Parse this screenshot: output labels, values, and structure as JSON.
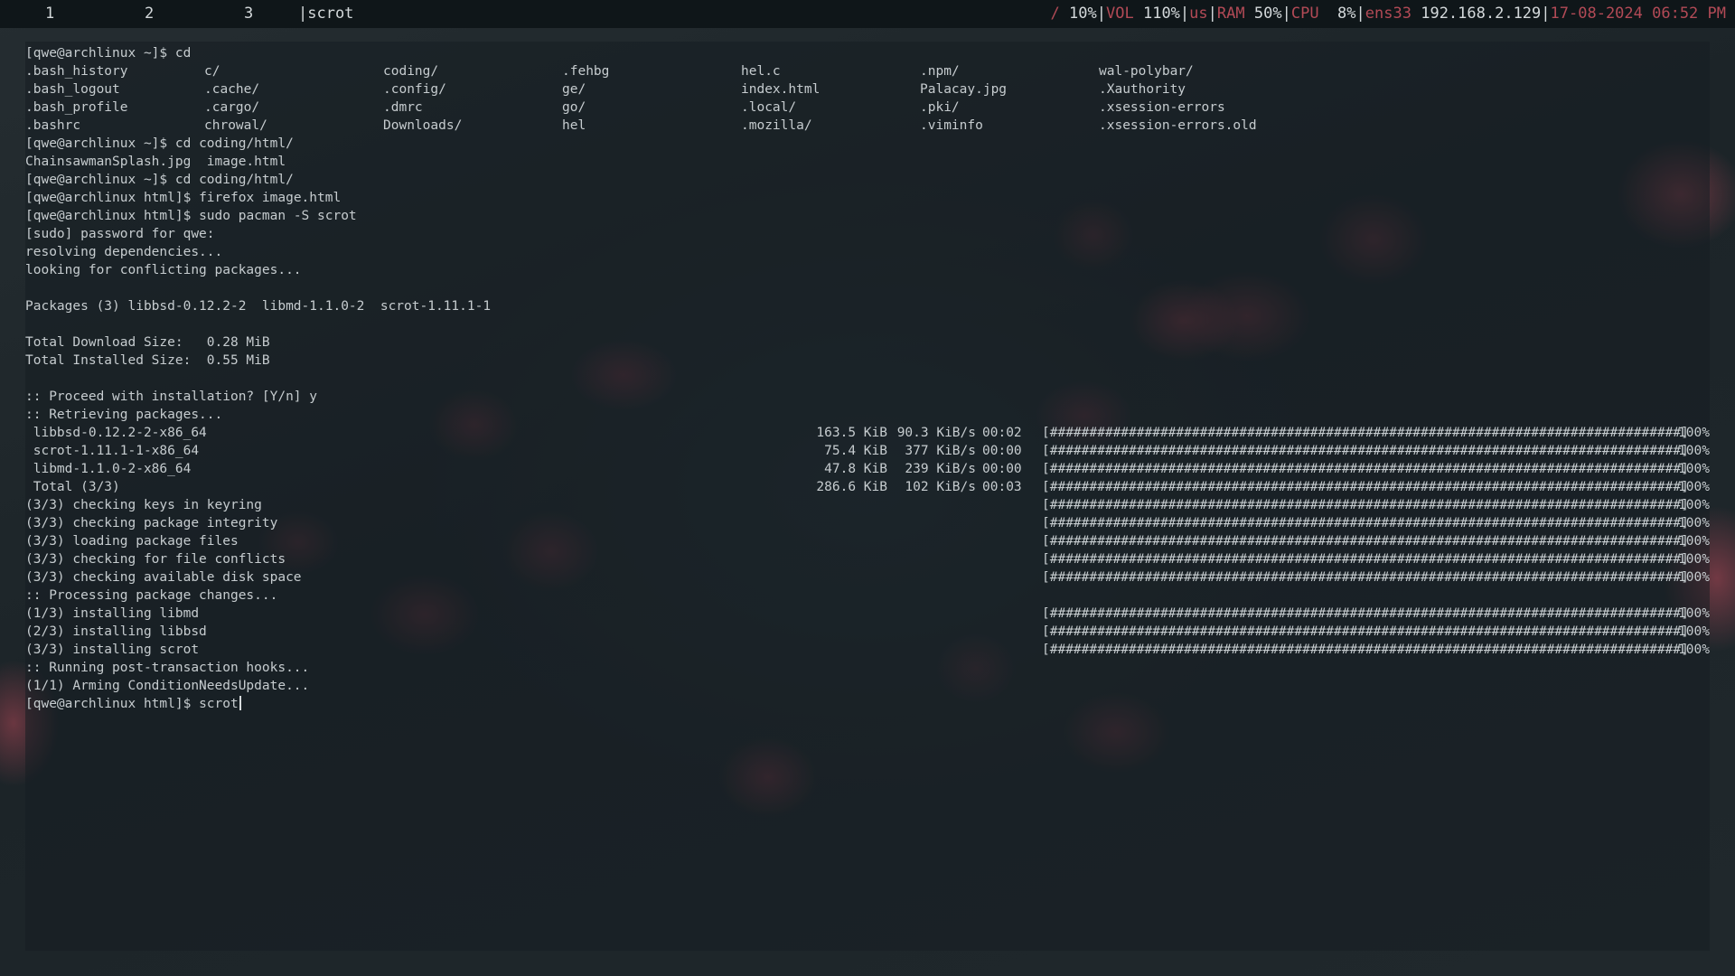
{
  "topbar": {
    "workspaces": [
      "1",
      "2",
      "3"
    ],
    "window_title": "|scrot",
    "status": {
      "disk_label": "/",
      "disk_value": "10%",
      "vol_label": "VOL",
      "vol_value": "110%",
      "layout_label": "us",
      "ram_label": "RAM",
      "ram_value": "50%",
      "cpu_label": "CPU",
      "cpu_value": "8%",
      "net_label": "ens33",
      "net_value": "192.168.2.129",
      "datetime": "17-08-2024 06:52 PM"
    }
  },
  "terminal": {
    "prompt_home": "[qwe@archlinux ~]$",
    "prompt_html": "[qwe@archlinux html]$",
    "cmd1": "cd",
    "ls_grid": [
      [
        ".bash_history",
        "c/",
        "coding/",
        ".fehbg",
        "hel.c",
        ".npm/",
        "wal-polybar/"
      ],
      [
        ".bash_logout",
        ".cache/",
        ".config/",
        "ge/",
        "index.html",
        "Palacay.jpg",
        ".Xauthority"
      ],
      [
        ".bash_profile",
        ".cargo/",
        ".dmrc",
        "go/",
        ".local/",
        ".pki/",
        ".xsession-errors"
      ],
      [
        ".bashrc",
        "chrowal/",
        "Downloads/",
        "hel",
        ".mozilla/",
        ".viminfo",
        ".xsession-errors.old"
      ]
    ],
    "cmd2": "cd coding/html/",
    "ls2": "ChainsawmanSplash.jpg  image.html",
    "cmd3": "cd coding/html/",
    "cmd4": "firefox image.html",
    "cmd5": "sudo pacman -S scrot",
    "sudo_prompt": "[sudo] password for qwe:",
    "resolving": "resolving dependencies...",
    "conflicts": "looking for conflicting packages...",
    "packages": "Packages (3) libbsd-0.12.2-2  libmd-1.1.0-2  scrot-1.11.1-1",
    "download_size": "Total Download Size:   0.28 MiB",
    "installed_size": "Total Installed Size:  0.55 MiB",
    "proceed": ":: Proceed with installation? [Y/n] y",
    "retrieving": ":: Retrieving packages...",
    "downloads": [
      {
        "name": " libbsd-0.12.2-2-x86_64",
        "size": "163.5 KiB",
        "rate": "90.3 KiB/s",
        "time": "00:02"
      },
      {
        "name": " scrot-1.11.1-1-x86_64",
        "size": "75.4 KiB",
        "rate": "377 KiB/s",
        "time": "00:00"
      },
      {
        "name": " libmd-1.1.0-2-x86_64",
        "size": "47.8 KiB",
        "rate": "239 KiB/s",
        "time": "00:00"
      },
      {
        "name": " Total (3/3)",
        "size": "286.6 KiB",
        "rate": "102 KiB/s",
        "time": "00:03"
      }
    ],
    "checks": [
      "(3/3) checking keys in keyring",
      "(3/3) checking package integrity",
      "(3/3) loading package files",
      "(3/3) checking for file conflicts",
      "(3/3) checking available disk space"
    ],
    "processing": ":: Processing package changes...",
    "installs": [
      "(1/3) installing libmd",
      "(2/3) installing libbsd",
      "(3/3) installing scrot"
    ],
    "hooks": ":: Running post-transaction hooks...",
    "arming": "(1/1) Arming ConditionNeedsUpdate...",
    "current_input": "scrot",
    "progress_bar": "[################################################################################]",
    "progress_pct": "100%"
  },
  "colors": {
    "bar_bg": "#0f1619",
    "bar_label": "#b24a56",
    "text": "#c6cccf"
  }
}
